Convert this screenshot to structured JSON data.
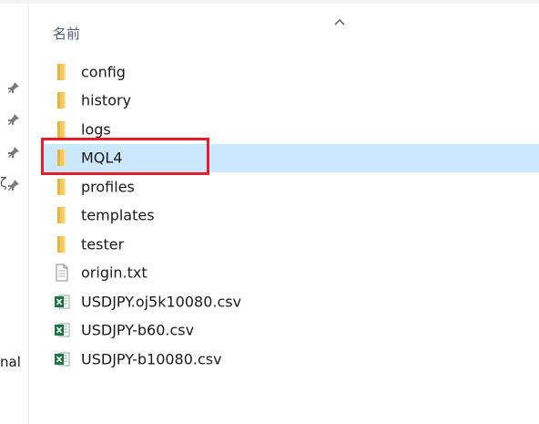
{
  "header": {
    "name_column_label": "名前"
  },
  "navigation": {
    "cut_off_label": "nal",
    "cut_off_char": "ζ"
  },
  "files": [
    {
      "name": "config",
      "type": "folder",
      "selected": false
    },
    {
      "name": "history",
      "type": "folder",
      "selected": false
    },
    {
      "name": "logs",
      "type": "folder",
      "selected": false
    },
    {
      "name": "MQL4",
      "type": "folder",
      "selected": true
    },
    {
      "name": "profiles",
      "type": "folder",
      "selected": false
    },
    {
      "name": "templates",
      "type": "folder",
      "selected": false
    },
    {
      "name": "tester",
      "type": "folder",
      "selected": false
    },
    {
      "name": "origin.txt",
      "type": "text-file",
      "selected": false
    },
    {
      "name": "USDJPY.oj5k10080.csv",
      "type": "excel-csv-file",
      "selected": false
    },
    {
      "name": "USDJPY-b60.csv",
      "type": "excel-csv-file",
      "selected": false
    },
    {
      "name": "USDJPY-b10080.csv",
      "type": "excel-csv-file",
      "selected": false
    }
  ],
  "colors": {
    "selection_background": "#cce8ff",
    "highlight_border": "#e0202a",
    "folder_yellow": "#f4c95d",
    "excel_green": "#1e7145"
  },
  "icons": {
    "folder": "folder-icon",
    "text-file": "text-file-icon",
    "excel-csv-file": "excel-file-icon",
    "pin": "pin-icon",
    "sort": "sort-ascending-chevron-icon"
  }
}
